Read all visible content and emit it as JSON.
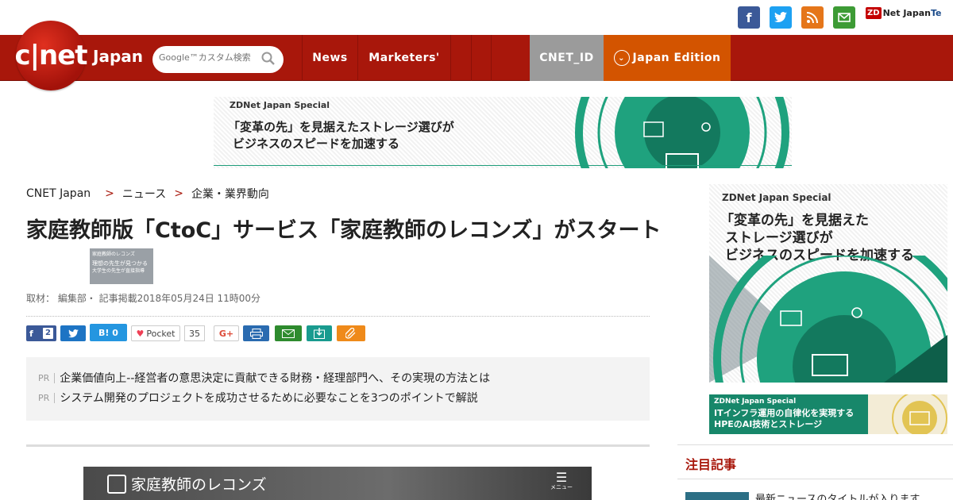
{
  "topbar": {
    "social": [
      "f",
      "t",
      "rss",
      "mail"
    ],
    "zdnet_zd": "ZD",
    "zdnet_label": "Net Japan",
    "te_label": "Te"
  },
  "nav": {
    "logo_text": "c|net",
    "logo_sub": "Japan",
    "search_placeholder": "Google™カスタム検索",
    "items": [
      "News",
      "Marketers'",
      "",
      "",
      "",
      "CNET_ID",
      "Japan Edition"
    ]
  },
  "banner_top": {
    "label": "ZDNet Japan Special",
    "line1": "「変革の先」を見据えたストレージ選びが",
    "line2": "ビジネスのスピードを加速する"
  },
  "banner_side": {
    "label": "ZDNet Japan Special",
    "line1": "「変革の先」を見据えた",
    "line2": "ストレージ選びが",
    "line3": "ビジネスのスピードを加速する"
  },
  "banner_small": {
    "label": "ZDNet Japan Special",
    "line1": "ITインフラ運用の自律化を実現する",
    "line2": "HPEのAI技術とストレージ"
  },
  "breadcrumb": {
    "home": "CNET Japan",
    "level1": "ニュース",
    "level2": "企業・業界動向"
  },
  "article": {
    "title": "家庭教師版「CtoC」サービス「家庭教師のレコンズ」がスタート",
    "thumb_line1": "家庭教師のレコンズ",
    "thumb_line2": "理想の先生が見つかる",
    "thumb_line3": "大学生の先生が直接指導",
    "byline": "取材： 編集部・ 記事掲載2018年05月24日 11時00分",
    "share": {
      "fb_count": "2",
      "twitter": "t",
      "hatena": "B! 0",
      "pocket": "Pocket",
      "pocket_count": "35",
      "gplus": "G+"
    },
    "pr": [
      {
        "tag": "PR",
        "text": "企業価値向上--経営者の意思決定に貢献できる財務・経理部門へ、その実現の方法とは"
      },
      {
        "tag": "PR",
        "text": "システム開発のプロジェクトを成功させるために必要なことを3つのポイントで解説"
      }
    ],
    "image_brand": "家庭教師のレコンズ",
    "image_menu": "メニュー"
  },
  "side": {
    "section_title": "注目記事",
    "first_item": "最新ニュースのタイトルが入ります"
  },
  "colors": {
    "brand_red": "#a8170b",
    "nav_gray": "#9b9b9b",
    "nav_orange": "#d35400",
    "accent_green": "#1f9e7b"
  }
}
